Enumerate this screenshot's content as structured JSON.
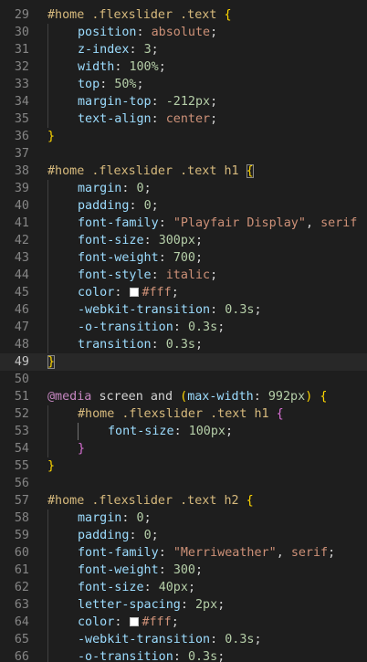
{
  "theme": {
    "background": "#1e1e1e",
    "current_line": "#282828",
    "gutter_text": "#858585",
    "colors": {
      "sel": "#d7ba7d",
      "prop": "#9cdcfe",
      "num": "#b5cea8",
      "str": "#ce9178",
      "punc": "#d4d4d4",
      "brace": "#ffd700",
      "brace2": "#da70d6",
      "at": "#c586c0",
      "kw": "#d4d4d4",
      "swatch": "#ffffff"
    }
  },
  "lines": [
    {
      "n": "29",
      "indent": 0,
      "tokens": [
        [
          "sel",
          "#home .flexslider .text"
        ],
        [
          "punc",
          " "
        ],
        [
          "brace",
          "{"
        ]
      ]
    },
    {
      "n": "30",
      "indent": 1,
      "tokens": [
        [
          "prop",
          "position"
        ],
        [
          "punc",
          ": "
        ],
        [
          "str",
          "absolute"
        ],
        [
          "punc",
          ";"
        ]
      ]
    },
    {
      "n": "31",
      "indent": 1,
      "tokens": [
        [
          "prop",
          "z-index"
        ],
        [
          "punc",
          ": "
        ],
        [
          "num",
          "3"
        ],
        [
          "punc",
          ";"
        ]
      ]
    },
    {
      "n": "32",
      "indent": 1,
      "tokens": [
        [
          "prop",
          "width"
        ],
        [
          "punc",
          ": "
        ],
        [
          "num",
          "100%"
        ],
        [
          "punc",
          ";"
        ]
      ]
    },
    {
      "n": "33",
      "indent": 1,
      "tokens": [
        [
          "prop",
          "top"
        ],
        [
          "punc",
          ": "
        ],
        [
          "num",
          "50%"
        ],
        [
          "punc",
          ";"
        ]
      ]
    },
    {
      "n": "34",
      "indent": 1,
      "tokens": [
        [
          "prop",
          "margin-top"
        ],
        [
          "punc",
          ": "
        ],
        [
          "num",
          "-212px"
        ],
        [
          "punc",
          ";"
        ]
      ]
    },
    {
      "n": "35",
      "indent": 1,
      "tokens": [
        [
          "prop",
          "text-align"
        ],
        [
          "punc",
          ": "
        ],
        [
          "str",
          "center"
        ],
        [
          "punc",
          ";"
        ]
      ]
    },
    {
      "n": "36",
      "indent": 0,
      "tokens": [
        [
          "brace",
          "}"
        ]
      ]
    },
    {
      "n": "37",
      "indent": 0,
      "tokens": []
    },
    {
      "n": "38",
      "indent": 0,
      "tokens": [
        [
          "sel",
          "#home .flexslider .text h1"
        ],
        [
          "punc",
          " "
        ],
        [
          "brace",
          "{",
          "match"
        ]
      ]
    },
    {
      "n": "39",
      "indent": 1,
      "tokens": [
        [
          "prop",
          "margin"
        ],
        [
          "punc",
          ": "
        ],
        [
          "num",
          "0"
        ],
        [
          "punc",
          ";"
        ]
      ]
    },
    {
      "n": "40",
      "indent": 1,
      "tokens": [
        [
          "prop",
          "padding"
        ],
        [
          "punc",
          ": "
        ],
        [
          "num",
          "0"
        ],
        [
          "punc",
          ";"
        ]
      ]
    },
    {
      "n": "41",
      "indent": 1,
      "tokens": [
        [
          "prop",
          "font-family"
        ],
        [
          "punc",
          ": "
        ],
        [
          "str",
          "\"Playfair Display\""
        ],
        [
          "punc",
          ", "
        ],
        [
          "str",
          "serif"
        ]
      ]
    },
    {
      "n": "42",
      "indent": 1,
      "tokens": [
        [
          "prop",
          "font-size"
        ],
        [
          "punc",
          ": "
        ],
        [
          "num",
          "300px"
        ],
        [
          "punc",
          ";"
        ]
      ]
    },
    {
      "n": "43",
      "indent": 1,
      "tokens": [
        [
          "prop",
          "font-weight"
        ],
        [
          "punc",
          ": "
        ],
        [
          "num",
          "700"
        ],
        [
          "punc",
          ";"
        ]
      ]
    },
    {
      "n": "44",
      "indent": 1,
      "tokens": [
        [
          "prop",
          "font-style"
        ],
        [
          "punc",
          ": "
        ],
        [
          "str",
          "italic"
        ],
        [
          "punc",
          ";"
        ]
      ]
    },
    {
      "n": "45",
      "indent": 1,
      "tokens": [
        [
          "prop",
          "color"
        ],
        [
          "punc",
          ": "
        ],
        [
          "swatch",
          ""
        ],
        [
          "str",
          "#fff"
        ],
        [
          "punc",
          ";"
        ]
      ]
    },
    {
      "n": "46",
      "indent": 1,
      "tokens": [
        [
          "prop",
          "-webkit-transition"
        ],
        [
          "punc",
          ": "
        ],
        [
          "num",
          "0.3s"
        ],
        [
          "punc",
          ";"
        ]
      ]
    },
    {
      "n": "47",
      "indent": 1,
      "tokens": [
        [
          "prop",
          "-o-transition"
        ],
        [
          "punc",
          ": "
        ],
        [
          "num",
          "0.3s"
        ],
        [
          "punc",
          ";"
        ]
      ]
    },
    {
      "n": "48",
      "indent": 1,
      "tokens": [
        [
          "prop",
          "transition"
        ],
        [
          "punc",
          ": "
        ],
        [
          "num",
          "0.3s"
        ],
        [
          "punc",
          ";"
        ]
      ]
    },
    {
      "n": "49",
      "indent": 0,
      "current": true,
      "tokens": [
        [
          "brace",
          "}",
          "match"
        ]
      ]
    },
    {
      "n": "50",
      "indent": 0,
      "tokens": []
    },
    {
      "n": "51",
      "indent": 0,
      "tokens": [
        [
          "at",
          "@media"
        ],
        [
          "punc",
          " "
        ],
        [
          "kw",
          "screen"
        ],
        [
          "punc",
          " "
        ],
        [
          "kw",
          "and"
        ],
        [
          "punc",
          " "
        ],
        [
          "brace",
          "("
        ],
        [
          "prop",
          "max-width"
        ],
        [
          "punc",
          ": "
        ],
        [
          "num",
          "992px"
        ],
        [
          "brace",
          ")"
        ],
        [
          "punc",
          " "
        ],
        [
          "brace",
          "{"
        ]
      ]
    },
    {
      "n": "52",
      "indent": 1,
      "tokens": [
        [
          "sel",
          "#home .flexslider .text h1"
        ],
        [
          "punc",
          " "
        ],
        [
          "brace2",
          "{"
        ]
      ]
    },
    {
      "n": "53",
      "indent": 2,
      "tokens": [
        [
          "prop",
          "font-size"
        ],
        [
          "punc",
          ": "
        ],
        [
          "num",
          "100px"
        ],
        [
          "punc",
          ";"
        ]
      ]
    },
    {
      "n": "54",
      "indent": 1,
      "tokens": [
        [
          "brace2",
          "}"
        ]
      ]
    },
    {
      "n": "55",
      "indent": 0,
      "tokens": [
        [
          "brace",
          "}"
        ]
      ]
    },
    {
      "n": "56",
      "indent": 0,
      "tokens": []
    },
    {
      "n": "57",
      "indent": 0,
      "tokens": [
        [
          "sel",
          "#home .flexslider .text h2"
        ],
        [
          "punc",
          " "
        ],
        [
          "brace",
          "{"
        ]
      ]
    },
    {
      "n": "58",
      "indent": 1,
      "tokens": [
        [
          "prop",
          "margin"
        ],
        [
          "punc",
          ": "
        ],
        [
          "num",
          "0"
        ],
        [
          "punc",
          ";"
        ]
      ]
    },
    {
      "n": "59",
      "indent": 1,
      "tokens": [
        [
          "prop",
          "padding"
        ],
        [
          "punc",
          ": "
        ],
        [
          "num",
          "0"
        ],
        [
          "punc",
          ";"
        ]
      ]
    },
    {
      "n": "60",
      "indent": 1,
      "tokens": [
        [
          "prop",
          "font-family"
        ],
        [
          "punc",
          ": "
        ],
        [
          "str",
          "\"Merriweather\""
        ],
        [
          "punc",
          ", "
        ],
        [
          "str",
          "serif"
        ],
        [
          "punc",
          ";"
        ]
      ]
    },
    {
      "n": "61",
      "indent": 1,
      "tokens": [
        [
          "prop",
          "font-weight"
        ],
        [
          "punc",
          ": "
        ],
        [
          "num",
          "300"
        ],
        [
          "punc",
          ";"
        ]
      ]
    },
    {
      "n": "62",
      "indent": 1,
      "tokens": [
        [
          "prop",
          "font-size"
        ],
        [
          "punc",
          ": "
        ],
        [
          "num",
          "40px"
        ],
        [
          "punc",
          ";"
        ]
      ]
    },
    {
      "n": "63",
      "indent": 1,
      "tokens": [
        [
          "prop",
          "letter-spacing"
        ],
        [
          "punc",
          ": "
        ],
        [
          "num",
          "2px"
        ],
        [
          "punc",
          ";"
        ]
      ]
    },
    {
      "n": "64",
      "indent": 1,
      "tokens": [
        [
          "prop",
          "color"
        ],
        [
          "punc",
          ": "
        ],
        [
          "swatch",
          ""
        ],
        [
          "str",
          "#fff"
        ],
        [
          "punc",
          ";"
        ]
      ]
    },
    {
      "n": "65",
      "indent": 1,
      "tokens": [
        [
          "prop",
          "-webkit-transition"
        ],
        [
          "punc",
          ": "
        ],
        [
          "num",
          "0.3s"
        ],
        [
          "punc",
          ";"
        ]
      ]
    },
    {
      "n": "66",
      "indent": 1,
      "tokens": [
        [
          "prop",
          "-o-transition"
        ],
        [
          "punc",
          ": "
        ],
        [
          "num",
          "0.3s"
        ],
        [
          "punc",
          ";"
        ]
      ]
    }
  ]
}
